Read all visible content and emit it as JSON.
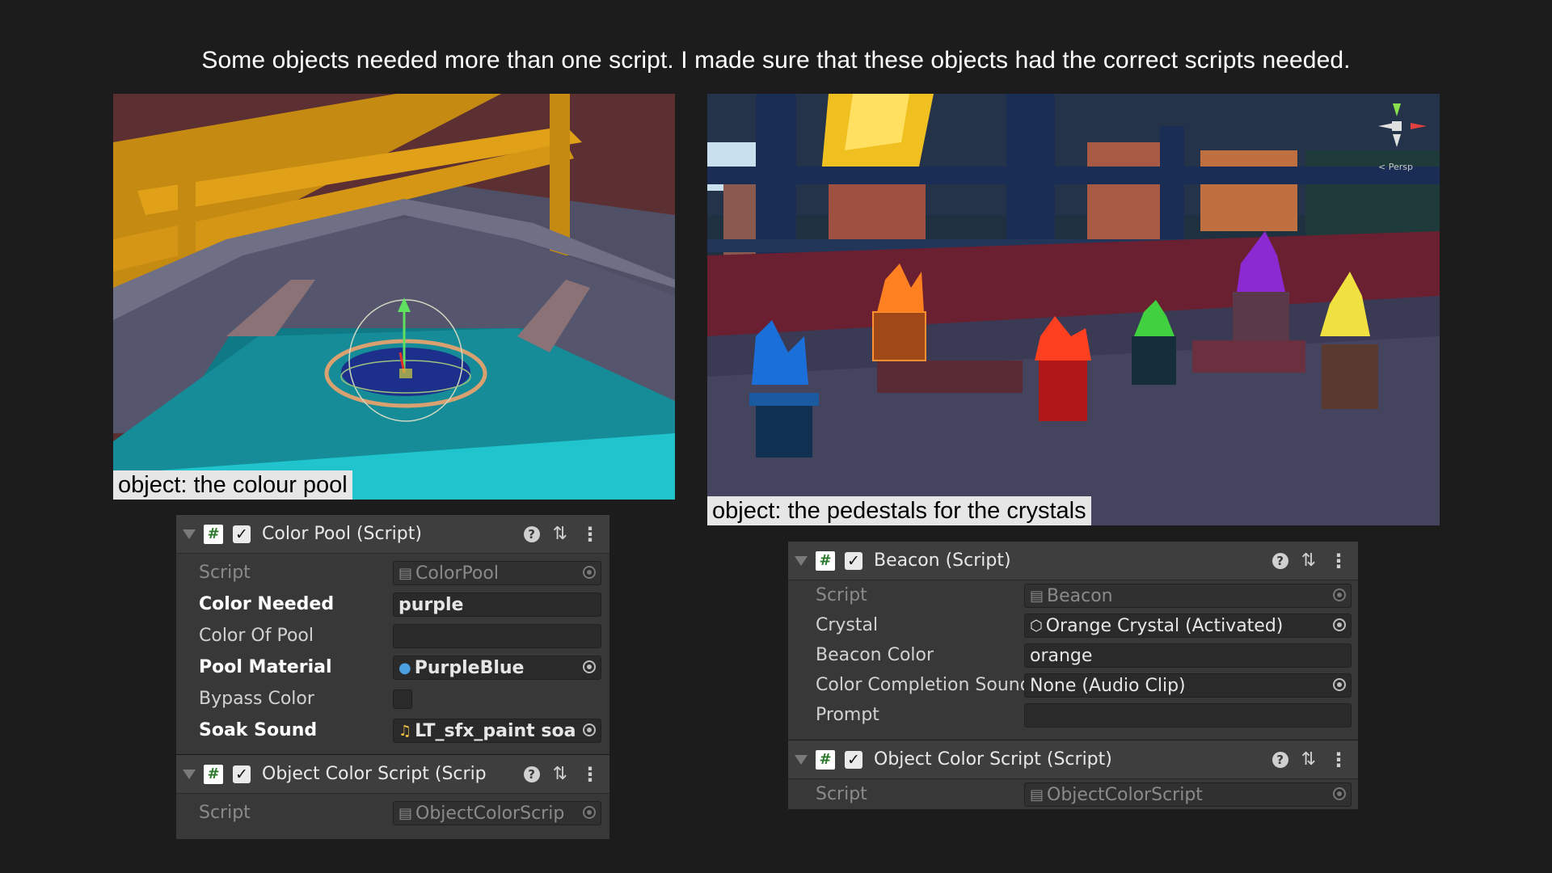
{
  "heading": "Some objects needed more than one script. I made sure that these objects had the correct scripts needed.",
  "left": {
    "caption": "object: the colour pool",
    "inspector": {
      "components": [
        {
          "title": "Color Pool (Script)",
          "fields": [
            {
              "label": "Script",
              "value": "ColorPool",
              "icon": "script-asset-icon"
            },
            {
              "label": "Color Needed",
              "value": "purple"
            },
            {
              "label": "Color Of Pool",
              "value": ""
            },
            {
              "label": "Pool Material",
              "value": "PurpleBlue",
              "icon": "material-sphere-icon"
            },
            {
              "label": "Bypass Color",
              "value": ""
            },
            {
              "label": "Soak Sound",
              "value": "LT_sfx_paint soa",
              "icon": "audio-clip-icon"
            }
          ]
        },
        {
          "title": "Object Color Script (Scrip",
          "fields": [
            {
              "label": "Script",
              "value": "ObjectColorScrip",
              "icon": "script-asset-icon"
            }
          ]
        }
      ]
    }
  },
  "right": {
    "caption": "object: the pedestals for the crystals",
    "gizmo_label": "< Persp",
    "inspector": {
      "components": [
        {
          "title": "Beacon (Script)",
          "fields": [
            {
              "label": "Script",
              "value": "Beacon",
              "icon": "script-asset-icon"
            },
            {
              "label": "Crystal",
              "value": "Orange Crystal (Activated)",
              "icon": "gameobject-cube-icon"
            },
            {
              "label": "Beacon Color",
              "value": "orange"
            },
            {
              "label": "Color Completion Sound",
              "value": "None (Audio Clip)"
            },
            {
              "label": "Prompt",
              "value": ""
            }
          ]
        },
        {
          "title": "Object Color Script (Script)",
          "fields": [
            {
              "label": "Script",
              "value": "ObjectColorScript",
              "icon": "script-asset-icon"
            }
          ]
        }
      ]
    }
  },
  "colors": {
    "background": "#1c1c1c",
    "panel": "#383838",
    "field": "#2a2a2a",
    "caption_bg": "#e6e6e6"
  }
}
